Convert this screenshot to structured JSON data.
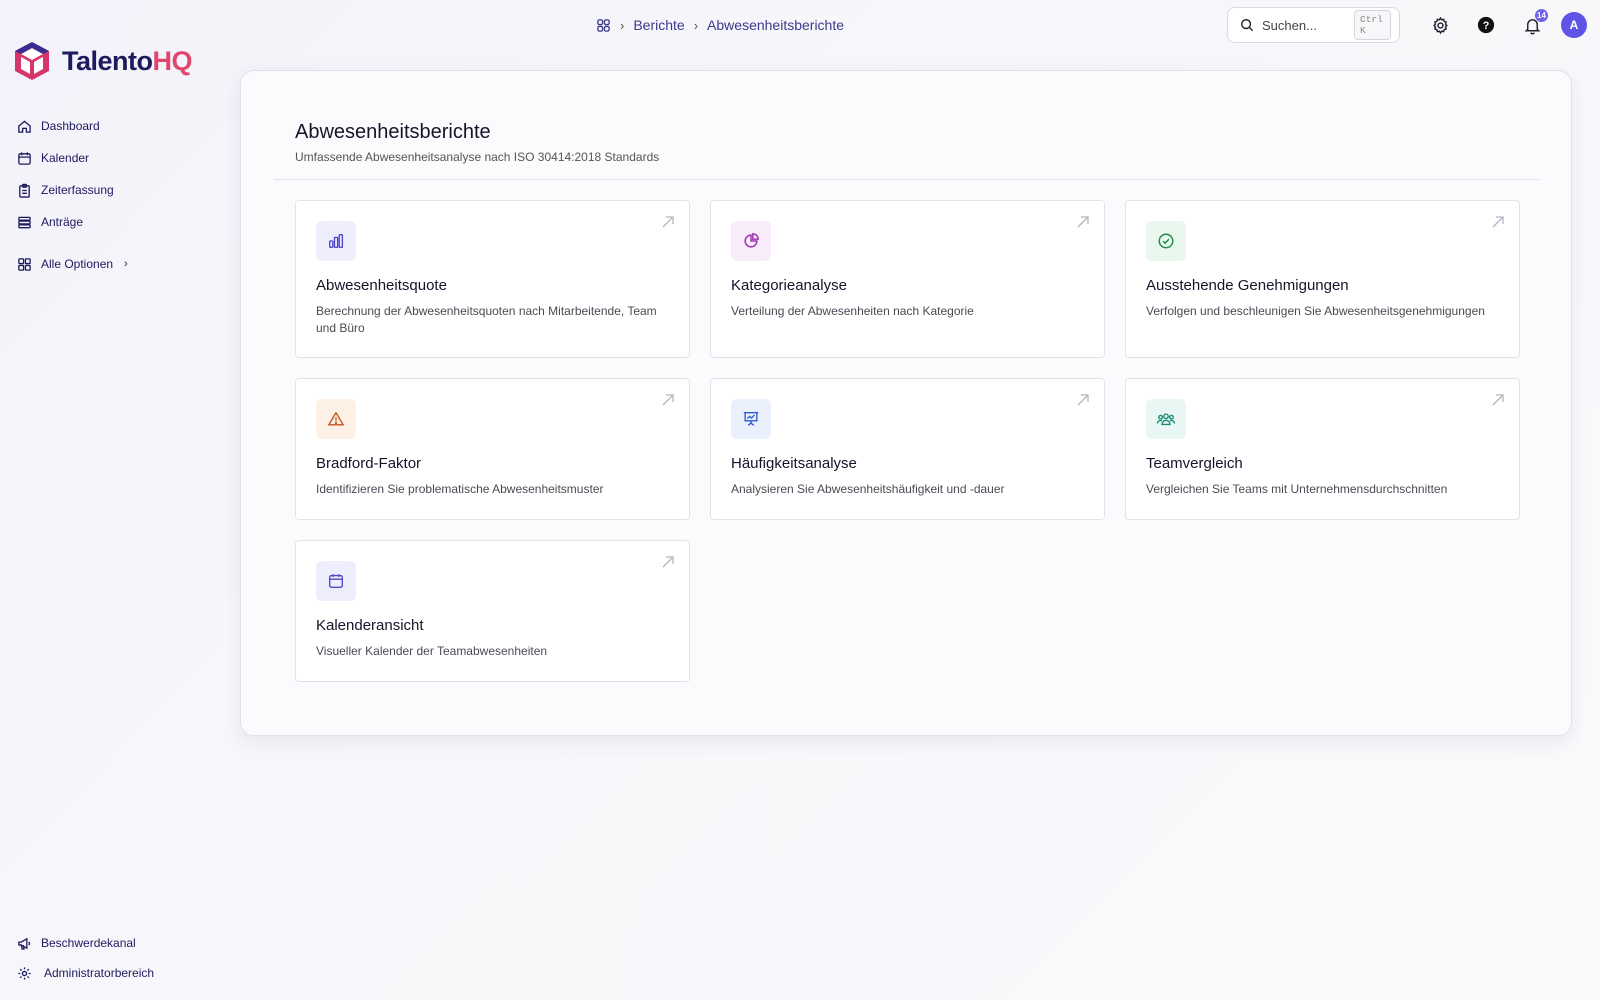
{
  "app": {
    "logo_main": "Talento",
    "logo_accent": "HQ"
  },
  "sidebar": {
    "items": [
      {
        "label": "Dashboard",
        "icon": "home-icon"
      },
      {
        "label": "Kalender",
        "icon": "calendar-icon"
      },
      {
        "label": "Zeiterfassung",
        "icon": "clipboard-icon"
      },
      {
        "label": "Anträge",
        "icon": "stack-icon"
      }
    ],
    "more_label": "Alle Optionen",
    "bottom_items": [
      {
        "label": "Beschwerdekanal",
        "icon": "megaphone-icon"
      },
      {
        "label": "Administratorbereich",
        "icon": "gear-icon"
      }
    ]
  },
  "breadcrumb": {
    "level1": "Berichte",
    "level2": "Abwesenheitsberichte"
  },
  "search": {
    "placeholder": "Suchen...",
    "shortcut": "Ctrl K"
  },
  "topbar": {
    "notification_count": "14",
    "avatar_initial": "A"
  },
  "main": {
    "title": "Abwesenheitsberichte",
    "subtitle": "Umfassende Abwesenheitsanalyse nach ISO 30414:2018 Standards",
    "cards": [
      {
        "title": "Abwesenheitsquote",
        "description": "Berechnung der Abwesenheitsquoten nach Mitarbeitende, Team und Büro",
        "icon": "bar-chart-icon",
        "color": "#4f46c8",
        "bg": "#eeedfb"
      },
      {
        "title": "Kategorieanalyse",
        "description": "Verteilung der Abwesenheiten nach Kategorie",
        "icon": "pie-chart-icon",
        "color": "#9b2fb0",
        "bg": "#f8ecfa"
      },
      {
        "title": "Ausstehende Genehmigungen",
        "description": "Verfolgen und beschleunigen Sie Abwesenheitsgenehmigungen",
        "icon": "check-circle-icon",
        "color": "#1f8a4c",
        "bg": "#eaf7ef"
      },
      {
        "title": "Bradford-Faktor",
        "description": "Identifizieren Sie problematische Abwesenheitsmuster",
        "icon": "warning-icon",
        "color": "#c2531b",
        "bg": "#fdf1e6"
      },
      {
        "title": "Häufigkeitsanalyse",
        "description": "Analysieren Sie Abwesenheitshäufigkeit und -dauer",
        "icon": "presentation-chart-icon",
        "color": "#2e5bd6",
        "bg": "#eaf0fc"
      },
      {
        "title": "Teamvergleich",
        "description": "Vergleichen Sie Teams mit Unternehmensdurchschnitten",
        "icon": "users-icon",
        "color": "#1a8a74",
        "bg": "#e8f7f3"
      },
      {
        "title": "Kalenderansicht",
        "description": "Visueller Kalender der Teamabwesenheiten",
        "icon": "calendar-icon",
        "color": "#4f46c8",
        "bg": "#eeedfb"
      }
    ]
  }
}
